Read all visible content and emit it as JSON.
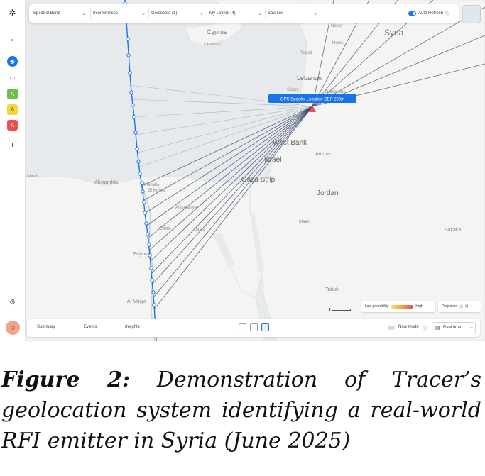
{
  "filterbar": {
    "spectral_band": "Spectral Band",
    "interferences": "Interferences",
    "geolocate": "Geolocate (1)",
    "my_layers": "My Layers (4)",
    "sources": "Sources",
    "auto_refresh": "Auto Refresh"
  },
  "sidebar": {
    "items": [
      {
        "icon": "search-icon"
      },
      {
        "icon": "globe-icon",
        "color": "#1a73e8"
      },
      {
        "icon": "folder-icon"
      },
      {
        "icon": "layer-a-icon",
        "color": "#6cc04a",
        "label": "A"
      },
      {
        "icon": "layer-a-icon",
        "color": "#f4d63b",
        "label": "A"
      },
      {
        "icon": "layer-a-icon",
        "color": "#e9504f",
        "label": "A"
      },
      {
        "icon": "plus-icon",
        "label": "+"
      }
    ]
  },
  "map": {
    "emitter_label": "GPS Spoofer Location CEP 200m",
    "places": [
      {
        "name": "Syria"
      },
      {
        "name": "Hama"
      },
      {
        "name": "Homs"
      },
      {
        "name": "Tripoli"
      },
      {
        "name": "Lebanon"
      },
      {
        "name": "Sidon"
      },
      {
        "name": "Damascus"
      },
      {
        "name": "Cyprus"
      },
      {
        "name": "Limassol"
      },
      {
        "name": "West Bank"
      },
      {
        "name": "Israel"
      },
      {
        "name": "Amman"
      },
      {
        "name": "Gaza Strip"
      },
      {
        "name": "Jordan"
      },
      {
        "name": "Alexandria"
      },
      {
        "name": "Mahalla El Kubra"
      },
      {
        "name": "Al Ismailiya"
      },
      {
        "name": "Cairo"
      },
      {
        "name": "Suez"
      },
      {
        "name": "Faiyum"
      },
      {
        "name": "Maan"
      },
      {
        "name": "Sakaka"
      },
      {
        "name": "Tabuk"
      },
      {
        "name": "Al Minya"
      },
      {
        "name": "Matruh"
      }
    ]
  },
  "legend": {
    "low": "Low probability",
    "high": "High",
    "projection": "Projection"
  },
  "bottombar": {
    "tabs": [
      "Summary",
      "Events",
      "Insights"
    ],
    "now_mode": "Now mode",
    "real_time": "Real time"
  },
  "caption": {
    "figure_label": "Figure 2:",
    "text": " Demonstration of Tracer’s geolocation system identifying a real-world RFI emitter in Syria (June 2025)"
  },
  "colors": {
    "accent": "#1a73e8",
    "sea": "#e7eaec",
    "land": "#f4f4f2",
    "emitter": "#e9504f",
    "bearing_line": "#2d3e66"
  }
}
